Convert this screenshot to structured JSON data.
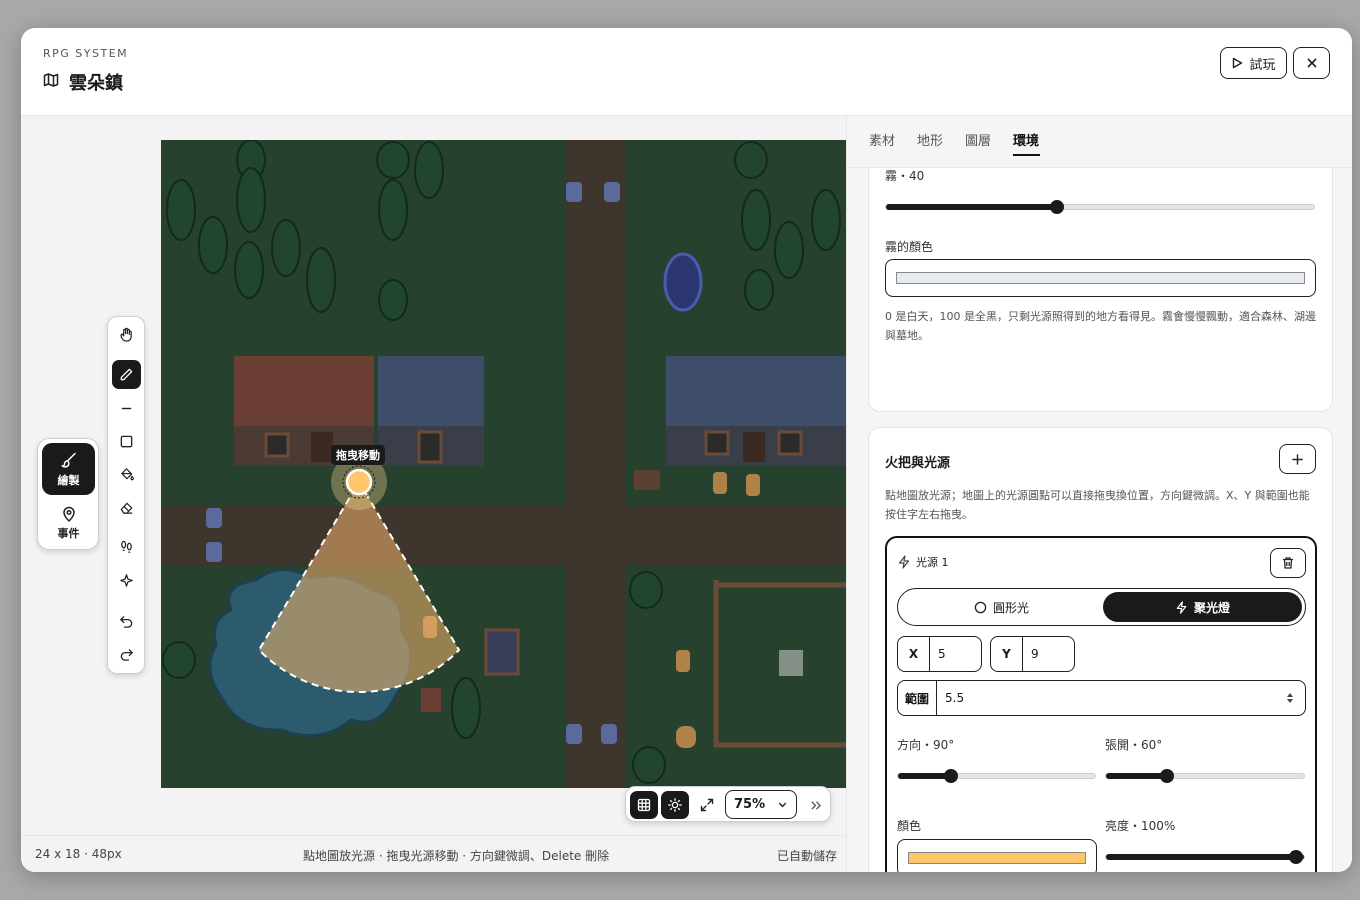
{
  "header": {
    "kicker": "RPG SYSTEM",
    "title": "雲朵鎮",
    "play_label": "試玩"
  },
  "modes": [
    {
      "label": "繪製",
      "icon": "brush-icon",
      "active": true
    },
    {
      "label": "事件",
      "icon": "map-pin-icon",
      "active": false
    }
  ],
  "tools": [
    "hand-icon",
    "pencil-icon",
    "line-icon",
    "rectangle-icon",
    "fill-bucket-icon",
    "eraser-icon",
    "footprints-icon",
    "sparkle-icon",
    "undo-icon",
    "redo-icon"
  ],
  "map": {
    "drag_tooltip": "拖曳移動"
  },
  "map_toolbar": {
    "zoom": "75%"
  },
  "status": {
    "size": "24 x 18 · 48px",
    "hint": "點地圖放光源 · 拖曳光源移動 · 方向鍵微調、Delete 刪除",
    "saved": "已自動儲存"
  },
  "tabs": [
    {
      "label": "素材"
    },
    {
      "label": "地形"
    },
    {
      "label": "圖層"
    },
    {
      "label": "環境",
      "active": true
    }
  ],
  "fog": {
    "label": "霧・40",
    "value": 40,
    "color_label": "霧的顏色",
    "color": "#e6ebf2",
    "hint": "0 是白天，100 是全黑，只剩光源照得到的地方看得見。霧會慢慢飄動，適合森林、湖邊與墓地。"
  },
  "lights": {
    "title": "火把與光源",
    "hint": "點地圖放光源；地圖上的光源圓點可以直接拖曳換位置，方向鍵微調。X、Y 與範圍也能按住字左右拖曳。",
    "item": {
      "name": "光源 1",
      "type_options": [
        "圓形光",
        "聚光燈"
      ],
      "selected_type": "聚光燈",
      "x_label": "X",
      "x": "5",
      "y_label": "Y",
      "y": "9",
      "range_label": "範圍",
      "range": "5.5",
      "direction_label": "方向・90°",
      "direction": 90,
      "spread_label": "張開・60°",
      "spread": 60,
      "color_label": "顏色",
      "color": "#ffc56a",
      "brightness_label": "亮度・100%",
      "brightness": 100
    }
  }
}
